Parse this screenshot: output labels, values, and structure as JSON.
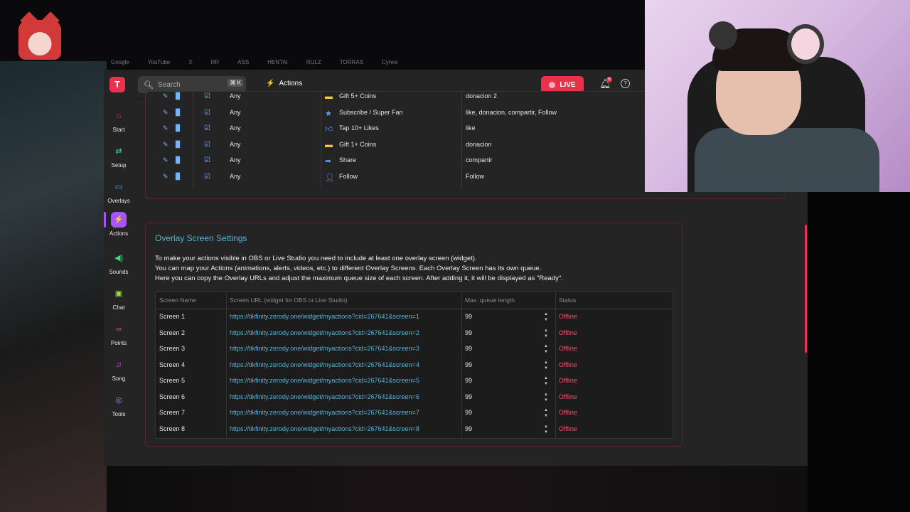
{
  "browser_bookmarks": [
    "Google",
    "YouTube",
    "X",
    "RR",
    "ASS",
    "HENTAI",
    "RULZ",
    "TORRAS",
    "Cynex"
  ],
  "search": {
    "placeholder": "Search",
    "shortcut": "⌘ K"
  },
  "breadcrumb": {
    "label": "Actions"
  },
  "live_button": {
    "label": "LIVE"
  },
  "notifications": {
    "count": "6"
  },
  "sidebar": {
    "items": [
      {
        "label": "Start",
        "icon": "home-icon"
      },
      {
        "label": "Setup",
        "icon": "swap-icon"
      },
      {
        "label": "Overlays",
        "icon": "monitor-icon"
      },
      {
        "label": "Actions",
        "icon": "bolt-icon"
      },
      {
        "label": "Sounds",
        "icon": "speaker-icon"
      },
      {
        "label": "Chat",
        "icon": "chat-icon"
      },
      {
        "label": "Points",
        "icon": "points-icon"
      },
      {
        "label": "Song",
        "icon": "music-icon"
      },
      {
        "label": "Tools",
        "icon": "gamepad-icon"
      }
    ]
  },
  "actions_rows": [
    {
      "user": "Any",
      "event": "Gift 5+ Coins",
      "event_icon": "coins-icon",
      "actions": "donacion 2"
    },
    {
      "user": "Any",
      "event": "Subscribe / Super Fan",
      "event_icon": "star-icon",
      "actions": "like, donacion, compartir, Follow"
    },
    {
      "user": "Any",
      "event": "Tap 10+ Likes",
      "event_icon": "thumbs-up-icon",
      "actions": "like"
    },
    {
      "user": "Any",
      "event": "Gift 1+ Coins",
      "event_icon": "coins-icon",
      "actions": "donacion"
    },
    {
      "user": "Any",
      "event": "Share",
      "event_icon": "share-icon",
      "actions": "compartir"
    },
    {
      "user": "Any",
      "event": "Follow",
      "event_icon": "follow-icon",
      "actions": "Follow"
    }
  ],
  "overlay_settings": {
    "title": "Overlay Screen Settings",
    "desc_1": "To make your actions visible in OBS or Live Studio you need to include at least one overlay screen (widget).",
    "desc_2": "You can map your Actions (animations, alerts, videos, etc.) to different Overlay Screens. Each Overlay Screen has its own queue.",
    "desc_3": "Here you can copy the Overlay URLs and adjust the maximum queue size of each screen. After adding it, it will be displayed as \"Ready\".",
    "columns": [
      "Screen Name",
      "Screen URL (widget for OBS or Live Studio)",
      "Max. queue length",
      "Status"
    ],
    "rows": [
      {
        "name": "Screen 1",
        "url": "https://tikfinity.zerody.one/widget/myactions?cid=267641&screen=1",
        "queue": "99",
        "status": "Offline"
      },
      {
        "name": "Screen 2",
        "url": "https://tikfinity.zerody.one/widget/myactions?cid=267641&screen=2",
        "queue": "99",
        "status": "Offline"
      },
      {
        "name": "Screen 3",
        "url": "https://tikfinity.zerody.one/widget/myactions?cid=267641&screen=3",
        "queue": "99",
        "status": "Offline"
      },
      {
        "name": "Screen 4",
        "url": "https://tikfinity.zerody.one/widget/myactions?cid=267641&screen=4",
        "queue": "99",
        "status": "Offline"
      },
      {
        "name": "Screen 5",
        "url": "https://tikfinity.zerody.one/widget/myactions?cid=267641&screen=5",
        "queue": "99",
        "status": "Offline"
      },
      {
        "name": "Screen 6",
        "url": "https://tikfinity.zerody.one/widget/myactions?cid=267641&screen=6",
        "queue": "99",
        "status": "Offline"
      },
      {
        "name": "Screen 7",
        "url": "https://tikfinity.zerody.one/widget/myactions?cid=267641&screen=7",
        "queue": "99",
        "status": "Offline"
      },
      {
        "name": "Screen 8",
        "url": "https://tikfinity.zerody.one/widget/myactions?cid=267641&screen=8",
        "queue": "99",
        "status": "Offline"
      }
    ]
  },
  "colors": {
    "accent": "#e8334a",
    "active_nav": "#a855f7",
    "link": "#56b3d8",
    "offline": "#f0506e"
  }
}
